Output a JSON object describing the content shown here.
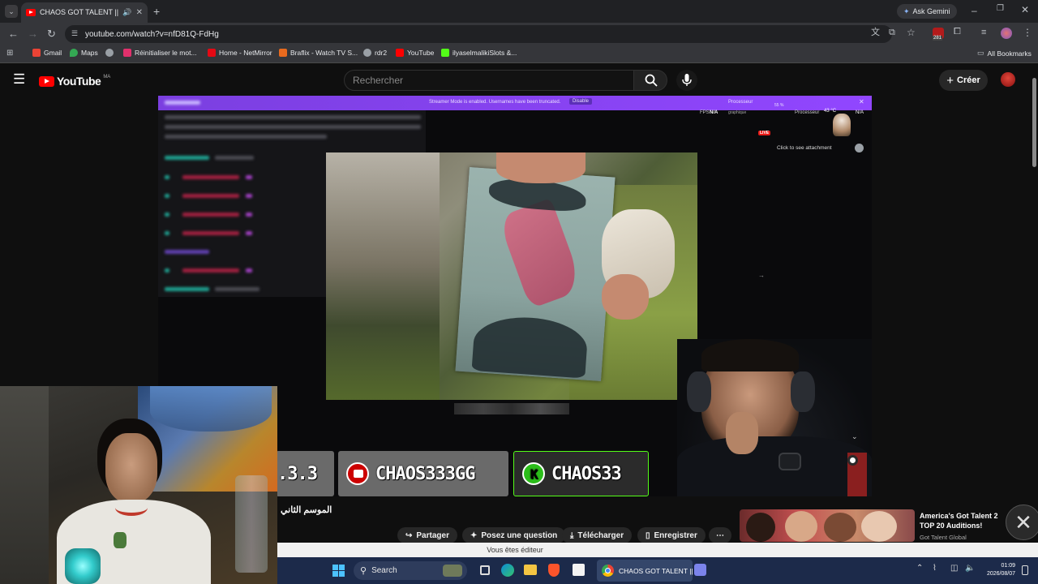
{
  "browser": {
    "tab_title": "CHAOS GOT TALENT || ⭐ .",
    "ask_gemini": "Ask Gemini",
    "url": "youtube.com/watch?v=nfD81Q-FdHg",
    "bookmarks": [
      {
        "label": "Gmail",
        "color": "#ea4335"
      },
      {
        "label": "Maps",
        "color": "#34a853"
      },
      {
        "label": "",
        "color": "#9aa0a6"
      },
      {
        "label": "Réinitialiser le mot...",
        "color": "#e1306c"
      },
      {
        "label": "Home - NetMirror",
        "color": "#e50914"
      },
      {
        "label": "Braflix - Watch TV S...",
        "color": "#e86a1e"
      },
      {
        "label": "rdr2",
        "color": "#9aa0a6"
      },
      {
        "label": "YouTube",
        "color": "#ff0000"
      },
      {
        "label": "ilyaselmalikiSlots &...",
        "color": "#53fc18"
      }
    ],
    "all_bookmarks": "All Bookmarks",
    "extension_badge": "281"
  },
  "youtube": {
    "logo_text": "YouTube",
    "logo_region": "MA",
    "search_placeholder": "Rechercher",
    "create_label": "Créer"
  },
  "player": {
    "banner_text": "Streamer Mode is enabled. Usernames have been truncated.",
    "banner_button": "Disable",
    "fps_label": "FPS",
    "fps_value": "N/A",
    "processor_label": "Processeur",
    "graphic_label": "graphique",
    "processor_percent": "55 %",
    "cpu_temp": "43 °C",
    "cpu_na": "N/A",
    "live_badge": "LIVE",
    "attachment_hint": "Click to see attachment",
    "chips": [
      {
        "text": ".3.3",
        "platform": "none"
      },
      {
        "text": "CHAOS333GG",
        "platform": "youtube"
      },
      {
        "text": "CHAOS33",
        "platform": "kick"
      }
    ]
  },
  "video": {
    "title": "الموسم الثاني",
    "actions": {
      "share": "Partager",
      "ask": "Posez une question",
      "download": "Télécharger",
      "save": "Enregistrer"
    },
    "editor_notice": "Vous êtes éditeur"
  },
  "suggestion": {
    "title_line1": "America's Got Talent 2",
    "title_line2": "TOP 20 Auditions!",
    "channel": "Got Talent Global"
  },
  "taskbar": {
    "search_label": "Search",
    "chrome_label": "CHAOS GOT TALENT || 1",
    "time": "01:09",
    "date": "2026/08/07"
  }
}
